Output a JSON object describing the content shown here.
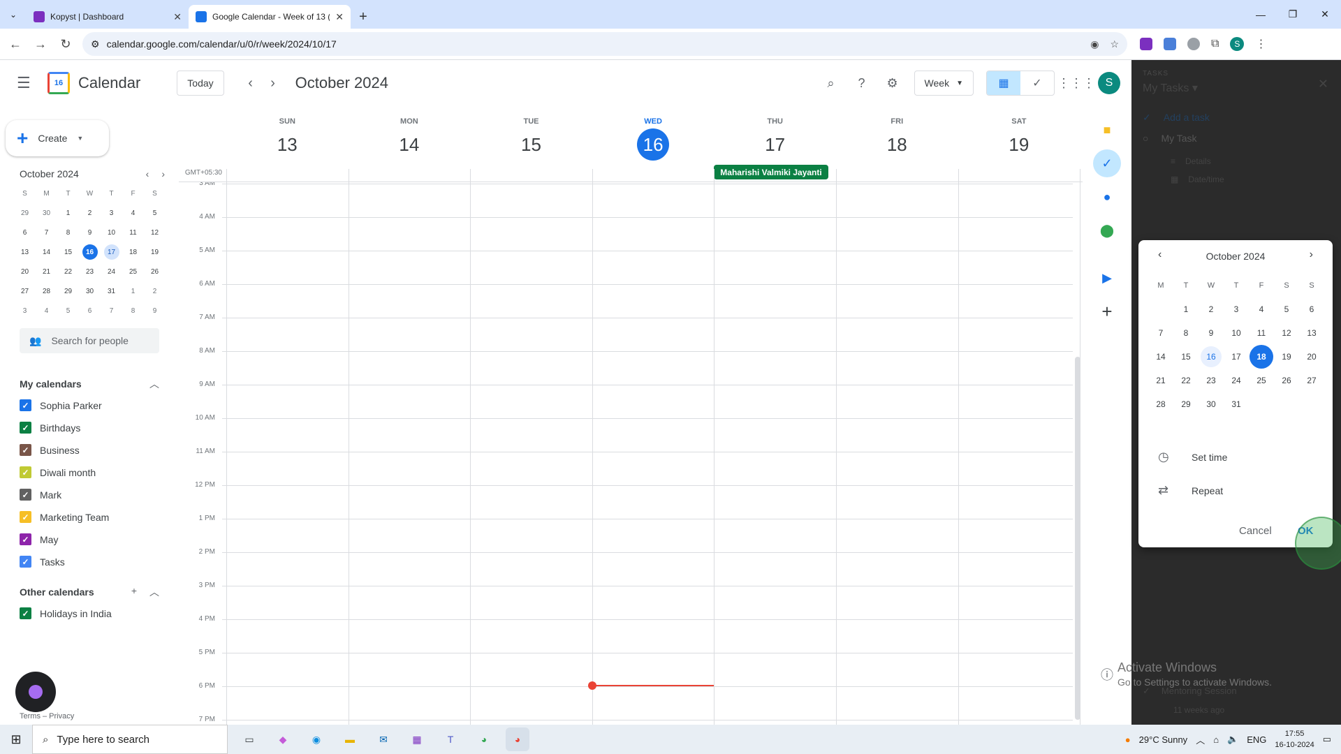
{
  "browser": {
    "tabs": [
      {
        "title": "Kopyst | Dashboard",
        "color": "#7b2fbf"
      },
      {
        "title": "Google Calendar - Week of 13 (",
        "color": "#1a73e8"
      }
    ],
    "url": "calendar.google.com/calendar/u/0/r/week/2024/10/17"
  },
  "header": {
    "app_name": "Calendar",
    "logo_day": "16",
    "today_label": "Today",
    "title": "October 2024",
    "view_label": "Week",
    "avatar_letter": "S"
  },
  "sidebar": {
    "create_label": "Create",
    "mini_title": "October 2024",
    "mini_weekdays": [
      "S",
      "M",
      "T",
      "W",
      "T",
      "F",
      "S"
    ],
    "mini_days": [
      "29",
      "30",
      "1",
      "2",
      "3",
      "4",
      "5",
      "6",
      "7",
      "8",
      "9",
      "10",
      "11",
      "12",
      "13",
      "14",
      "15",
      "16",
      "17",
      "18",
      "19",
      "20",
      "21",
      "22",
      "23",
      "24",
      "25",
      "26",
      "27",
      "28",
      "29",
      "30",
      "31",
      "1",
      "2",
      "3",
      "4",
      "5",
      "6",
      "7",
      "8",
      "9"
    ],
    "search_placeholder": "Search for people",
    "my_calendars_label": "My calendars",
    "my_calendars": [
      {
        "name": "Sophia Parker",
        "color": "#1a73e8"
      },
      {
        "name": "Birthdays",
        "color": "#0b8043"
      },
      {
        "name": "Business",
        "color": "#795548"
      },
      {
        "name": "Diwali month",
        "color": "#c0ca33"
      },
      {
        "name": "Mark",
        "color": "#616161"
      },
      {
        "name": "Marketing Team",
        "color": "#f6bf26"
      },
      {
        "name": "May",
        "color": "#8e24aa"
      },
      {
        "name": "Tasks",
        "color": "#4285f4"
      }
    ],
    "other_calendars_label": "Other calendars",
    "other_calendars": [
      {
        "name": "Holidays in India",
        "color": "#0b8043"
      }
    ],
    "footer": "Terms – Privacy"
  },
  "week": {
    "timezone": "GMT+05:30",
    "days": [
      {
        "dow": "SUN",
        "num": "13"
      },
      {
        "dow": "MON",
        "num": "14"
      },
      {
        "dow": "TUE",
        "num": "15"
      },
      {
        "dow": "WED",
        "num": "16"
      },
      {
        "dow": "THU",
        "num": "17"
      },
      {
        "dow": "FRI",
        "num": "18"
      },
      {
        "dow": "SAT",
        "num": "19"
      }
    ],
    "holiday": "Maharishi Valmiki Jayanti",
    "hours": [
      "3 AM",
      "4 AM",
      "5 AM",
      "6 AM",
      "7 AM",
      "8 AM",
      "9 AM",
      "10 AM",
      "11 AM",
      "12 PM",
      "1 PM",
      "2 PM",
      "3 PM",
      "4 PM",
      "5 PM",
      "6 PM",
      "7 PM"
    ]
  },
  "tasks_panel": {
    "section_label": "TASKS",
    "list_name": "My Tasks",
    "add_task": "Add a task",
    "task_title": "My Task",
    "details": "Details",
    "datetime": "Date/time",
    "completed_task": "Mentoring Session",
    "completed_ago": "11 weeks ago"
  },
  "date_picker": {
    "title": "October 2024",
    "weekdays": [
      "M",
      "T",
      "W",
      "T",
      "F",
      "S",
      "S"
    ],
    "days": [
      "",
      "1",
      "2",
      "3",
      "4",
      "5",
      "6",
      "7",
      "8",
      "9",
      "10",
      "11",
      "12",
      "13",
      "14",
      "15",
      "16",
      "17",
      "18",
      "19",
      "20",
      "21",
      "22",
      "23",
      "24",
      "25",
      "26",
      "27",
      "28",
      "29",
      "30",
      "31"
    ],
    "set_time": "Set time",
    "repeat": "Repeat",
    "cancel": "Cancel",
    "ok": "OK"
  },
  "activation": {
    "title": "Activate Windows",
    "subtitle": "Go to Settings to activate Windows."
  },
  "taskbar": {
    "search_placeholder": "Type here to search",
    "weather": "29°C  Sunny",
    "lang": "ENG",
    "time": "17:55",
    "date": "16-10-2024"
  }
}
